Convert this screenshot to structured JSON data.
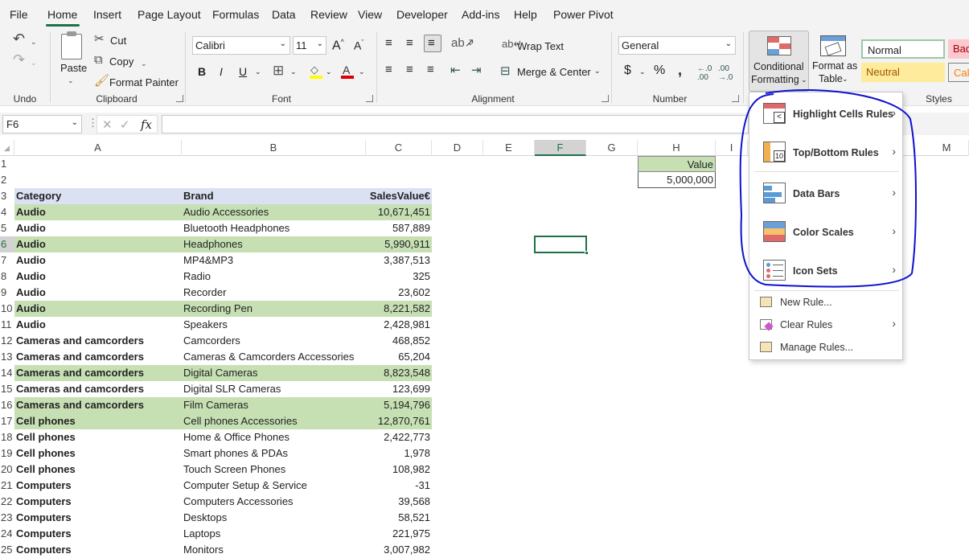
{
  "menubar": {
    "tabs": [
      "File",
      "Home",
      "Insert",
      "Page Layout",
      "Formulas",
      "Data",
      "Review",
      "View",
      "Developer",
      "Add-ins",
      "Help",
      "Power Pivot"
    ],
    "active_tab": "Home"
  },
  "ribbon": {
    "undo_group": "Undo",
    "clipboard": {
      "group": "Clipboard",
      "paste": "Paste",
      "cut": "Cut",
      "copy": "Copy",
      "format_painter": "Format Painter"
    },
    "font": {
      "group": "Font",
      "name": "Calibri",
      "size": "11"
    },
    "alignment": {
      "group": "Alignment",
      "wrap_text": "Wrap Text",
      "merge_center": "Merge & Center"
    },
    "number": {
      "group": "Number",
      "format": "General"
    },
    "styles": {
      "group": "Styles",
      "conditional_formatting_l1": "Conditional",
      "conditional_formatting_l2": "Formatting",
      "format_table_l1": "Format as",
      "format_table_l2": "Table",
      "normal": "Normal",
      "bad": "Bad",
      "neutral": "Neutral",
      "calc": "Calc"
    }
  },
  "formula_bar": {
    "name_box": "F6",
    "fx": "fx",
    "formula": ""
  },
  "columns": [
    "A",
    "B",
    "C",
    "D",
    "E",
    "F",
    "G",
    "H",
    "I",
    "M"
  ],
  "rows": [
    "1",
    "2",
    "3",
    "4",
    "5",
    "6",
    "7",
    "8",
    "9",
    "10",
    "11",
    "12",
    "13",
    "14",
    "15",
    "16",
    "17",
    "18",
    "19",
    "20",
    "21",
    "22",
    "23",
    "24",
    "25"
  ],
  "headers": {
    "category": "Category",
    "brand": "Brand",
    "sales": "SalesValue€"
  },
  "value_box": {
    "label": "Value",
    "value": "5,000,000"
  },
  "table": [
    {
      "category": "Audio",
      "brand": "Audio Accessories",
      "sales": "10,671,451",
      "hl": true
    },
    {
      "category": "Audio",
      "brand": "Bluetooth Headphones",
      "sales": "587,889",
      "hl": false
    },
    {
      "category": "Audio",
      "brand": "Headphones",
      "sales": "5,990,911",
      "hl": true
    },
    {
      "category": "Audio",
      "brand": "MP4&MP3",
      "sales": "3,387,513",
      "hl": false
    },
    {
      "category": "Audio",
      "brand": "Radio",
      "sales": "325",
      "hl": false
    },
    {
      "category": "Audio",
      "brand": "Recorder",
      "sales": "23,602",
      "hl": false
    },
    {
      "category": "Audio",
      "brand": "Recording Pen",
      "sales": "8,221,582",
      "hl": true
    },
    {
      "category": "Audio",
      "brand": "Speakers",
      "sales": "2,428,981",
      "hl": false
    },
    {
      "category": "Cameras and camcorders",
      "brand": "Camcorders",
      "sales": "468,852",
      "hl": false
    },
    {
      "category": "Cameras and camcorders",
      "brand": "Cameras & Camcorders Accessories",
      "sales": "65,204",
      "hl": false
    },
    {
      "category": "Cameras and camcorders",
      "brand": "Digital Cameras",
      "sales": "8,823,548",
      "hl": true
    },
    {
      "category": "Cameras and camcorders",
      "brand": "Digital SLR Cameras",
      "sales": "123,699",
      "hl": false
    },
    {
      "category": "Cameras and camcorders",
      "brand": "Film Cameras",
      "sales": "5,194,796",
      "hl": true
    },
    {
      "category": "Cell phones",
      "brand": "Cell phones Accessories",
      "sales": "12,870,761",
      "hl": true
    },
    {
      "category": "Cell phones",
      "brand": "Home & Office Phones",
      "sales": "2,422,773",
      "hl": false
    },
    {
      "category": "Cell phones",
      "brand": "Smart phones & PDAs",
      "sales": "1,978",
      "hl": false
    },
    {
      "category": "Cell phones",
      "brand": "Touch Screen Phones",
      "sales": "108,982",
      "hl": false
    },
    {
      "category": "Computers",
      "brand": "Computer Setup & Service",
      "sales": "-31",
      "hl": false
    },
    {
      "category": "Computers",
      "brand": "Computers Accessories",
      "sales": "39,568",
      "hl": false
    },
    {
      "category": "Computers",
      "brand": "Desktops",
      "sales": "58,521",
      "hl": false
    },
    {
      "category": "Computers",
      "brand": "Laptops",
      "sales": "221,975",
      "hl": false
    },
    {
      "category": "Computers",
      "brand": "Monitors",
      "sales": "3,007,982",
      "hl": false
    }
  ],
  "cf_menu": {
    "highlight": "Highlight Cells Rules",
    "topbottom": "Top/Bottom Rules",
    "databars": "Data Bars",
    "colorscales": "Color Scales",
    "iconsets": "Icon Sets",
    "newrule": "New Rule...",
    "clearrules": "Clear Rules",
    "managerules": "Manage Rules..."
  },
  "colors": {
    "accent_green": "#1e7145",
    "annotation": "#1010d0",
    "highlight_fill": "#c6e0b4",
    "header_fill": "#d9e1f2"
  }
}
